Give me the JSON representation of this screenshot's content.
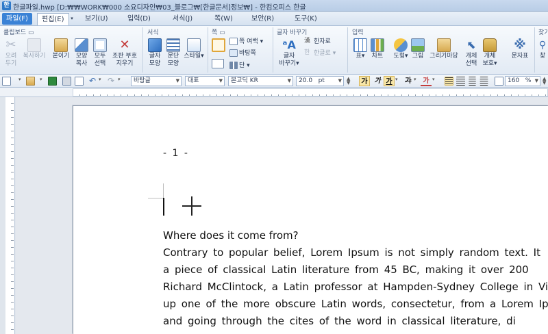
{
  "window": {
    "title": "한글파일.hwp [D:₩₩WORK₩000 소요디자인₩03_블로그₩[한글문서]정보₩] - 한컴오피스 한글"
  },
  "menubar": {
    "items": [
      "파일(F)",
      "편집(E)",
      "보기(U)",
      "입력(D)",
      "서식(J)",
      "쪽(W)",
      "보안(R)",
      "도구(K)"
    ],
    "active": "편집(E)"
  },
  "ribbon": {
    "groups": {
      "clipboard": "클립보드",
      "format": "서식",
      "page": "쪽",
      "text_change": "글자 바꾸기",
      "input": "입력",
      "find": "찾기"
    },
    "clipboard_buttons": [
      {
        "label1": "오려",
        "label2": "두기",
        "enabled": false
      },
      {
        "label1": "복사하기",
        "label2": "",
        "enabled": false
      },
      {
        "label1": "붙이기",
        "label2": "",
        "enabled": true
      },
      {
        "label1": "모양",
        "label2": "복사",
        "enabled": true
      },
      {
        "label1": "모두",
        "label2": "선택",
        "enabled": true
      },
      {
        "label1": "조판 부호",
        "label2": "지우기",
        "enabled": true
      }
    ],
    "format_buttons": [
      {
        "label1": "글자",
        "label2": "모양"
      },
      {
        "label1": "문단",
        "label2": "모양"
      },
      {
        "label1": "스타일",
        "label2": ""
      }
    ],
    "page_buttons": {
      "margin": "쪽 여백",
      "background": "바탕쪽",
      "column": "단"
    },
    "text_change": {
      "hanja": "한자로",
      "hangul": "한글로",
      "big1": "글자",
      "big2": "바꾸기"
    },
    "input_buttons": [
      {
        "label1": "표",
        "label2": ""
      },
      {
        "label1": "차트",
        "label2": ""
      },
      {
        "label1": "도형",
        "label2": ""
      },
      {
        "label1": "그림",
        "label2": ""
      },
      {
        "label1": "그리기마당",
        "label2": ""
      },
      {
        "label1": "개체",
        "label2": "선택"
      },
      {
        "label1": "개체",
        "label2": "보호"
      },
      {
        "label1": "문자표",
        "label2": ""
      },
      {
        "label1": "찾",
        "label2": ""
      }
    ]
  },
  "formatting": {
    "style": "바탕글",
    "lang": "대표",
    "font": "본고딕 KR",
    "size": "20.0",
    "size_unit": "pt",
    "bold": "가",
    "italic": "가",
    "underline": "가",
    "strike": "가",
    "color": "가",
    "zoom": "160",
    "zoom_unit": "%"
  },
  "document": {
    "page_number": "- 1 -",
    "heading": "Where does it come from?",
    "lines": [
      "Contrary to popular belief, Lorem Ipsum is not simply random text. It",
      "a piece of classical Latin literature from 45 BC, making it over 200",
      "Richard McClintock, a Latin professor at Hampden-Sydney College in Vi",
      "up one of the more obscure Latin words, consectetur, from a Lorem Ip",
      "and going through the cites of the word in classical literature, di"
    ]
  }
}
